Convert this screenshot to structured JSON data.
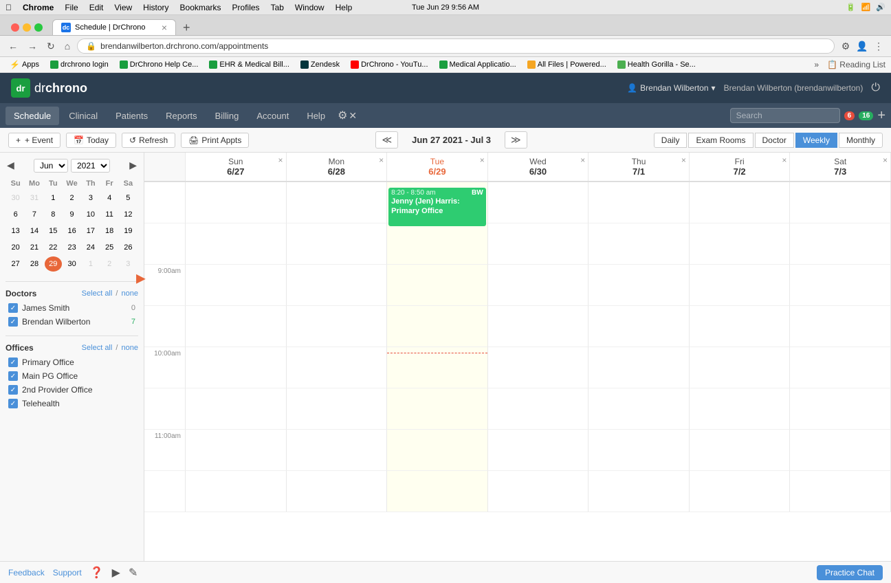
{
  "mac_bar": {
    "app_name": "Chrome",
    "menu_items": [
      "Chrome",
      "File",
      "Edit",
      "View",
      "History",
      "Bookmarks",
      "Profiles",
      "Tab",
      "Window",
      "Help"
    ],
    "time": "Tue Jun 29  9:56 AM"
  },
  "browser": {
    "tab_title": "Schedule | DrChrono",
    "tab_icon": "dc",
    "address": "brendanwilberton.drchrono.com/appointments",
    "bookmarks": [
      {
        "label": "Apps",
        "icon_color": "#4285f4"
      },
      {
        "label": "drchrono login",
        "icon_color": "#1a9e3f"
      },
      {
        "label": "DrChrono Help Ce...",
        "icon_color": "#1a9e3f"
      },
      {
        "label": "EHR & Medical Bill...",
        "icon_color": "#1a9e3f"
      },
      {
        "label": "Zendesk",
        "icon_color": "#03363d"
      },
      {
        "label": "DrChrono - YouTu...",
        "icon_color": "#ff0000"
      },
      {
        "label": "Medical Applicatio...",
        "icon_color": "#1a9e3f"
      },
      {
        "label": "All Files | Powered...",
        "icon_color": "#f5a623"
      },
      {
        "label": "Health Gorilla - Se...",
        "icon_color": "#4caf50"
      }
    ]
  },
  "app": {
    "logo_text_1": "dr",
    "logo_text_2": "chrono",
    "nav_items": [
      "Schedule",
      "Clinical",
      "Patients",
      "Reports",
      "Billing",
      "Account",
      "Help"
    ],
    "nav_active": "Schedule",
    "user_name": "Brendan Wilberton",
    "user_full": "Brendan Wilberton (brendanwilberton)",
    "search_placeholder": "Search",
    "notification_mail": "6",
    "notification_list": "16"
  },
  "schedule": {
    "toolbar": {
      "event_btn": "+ Event",
      "today_btn": "Today",
      "refresh_btn": "Refresh",
      "print_btn": "Print Appts",
      "date_range": "Jun 27 2021 - Jul 3",
      "views": [
        "Daily",
        "Exam Rooms",
        "Doctor",
        "Weekly",
        "Monthly"
      ],
      "active_view": "Weekly"
    },
    "mini_cal": {
      "month": "Jun",
      "year": "2021",
      "day_headers": [
        "Su",
        "Mo",
        "Tu",
        "We",
        "Th",
        "Fr",
        "Sa"
      ],
      "weeks": [
        [
          "30",
          "31",
          "1",
          "2",
          "3",
          "4",
          "5"
        ],
        [
          "6",
          "7",
          "8",
          "9",
          "10",
          "11",
          "12"
        ],
        [
          "13",
          "14",
          "15",
          "16",
          "17",
          "18",
          "19"
        ],
        [
          "20",
          "21",
          "22",
          "23",
          "24",
          "25",
          "26"
        ],
        [
          "27",
          "28",
          "29",
          "30",
          "1",
          "2",
          "3"
        ]
      ],
      "today_date": "29",
      "today_week_row": 4,
      "today_week_col": 2,
      "other_month_first": 2,
      "other_month_last_row": [
        false,
        false,
        false,
        false,
        true,
        true,
        true
      ]
    },
    "doctors": {
      "section_title": "Doctors",
      "select_all": "all",
      "select_none": "none",
      "items": [
        {
          "name": "James Smith",
          "count": "0",
          "checked": true
        },
        {
          "name": "Brendan Wilberton",
          "count": "7",
          "checked": true
        }
      ]
    },
    "offices": {
      "section_title": "Offices",
      "select_all": "all",
      "select_none": "none",
      "items": [
        {
          "name": "Primary Office",
          "checked": true
        },
        {
          "name": "Main PG Office",
          "checked": true
        },
        {
          "name": "2nd Provider Office",
          "checked": true
        },
        {
          "name": "Telehealth",
          "checked": true
        }
      ]
    },
    "calendar": {
      "day_headers": [
        {
          "day": "Sun",
          "date": "6/27",
          "col": 1
        },
        {
          "day": "Mon",
          "date": "6/28",
          "col": 2
        },
        {
          "day": "Tue",
          "date": "6/29",
          "col": 3,
          "today": true
        },
        {
          "day": "Wed",
          "date": "6/30",
          "col": 4
        },
        {
          "day": "Thu",
          "date": "7/1",
          "col": 5
        },
        {
          "day": "Fri",
          "date": "7/2",
          "col": 6
        },
        {
          "day": "Sat",
          "date": "7/3",
          "col": 7
        }
      ],
      "time_slots": [
        {
          "time": "9:00am",
          "slot": 0
        },
        {
          "time": "",
          "slot": 1
        },
        {
          "time": "10:00am",
          "slot": 4
        },
        {
          "time": "",
          "slot": 5
        },
        {
          "time": "11:00am",
          "slot": 8
        },
        {
          "time": "",
          "slot": 9
        }
      ],
      "appointments": [
        {
          "time": "8:20 - 8:50 am",
          "title": "Jenny (Jen) Harris: Primary Office",
          "initials": "BW",
          "col": 3,
          "row": -1,
          "color": "#2ecc71",
          "height": 60
        }
      ]
    }
  },
  "footer": {
    "feedback": "Feedback",
    "support": "Support",
    "practice_chat": "Practice Chat"
  }
}
